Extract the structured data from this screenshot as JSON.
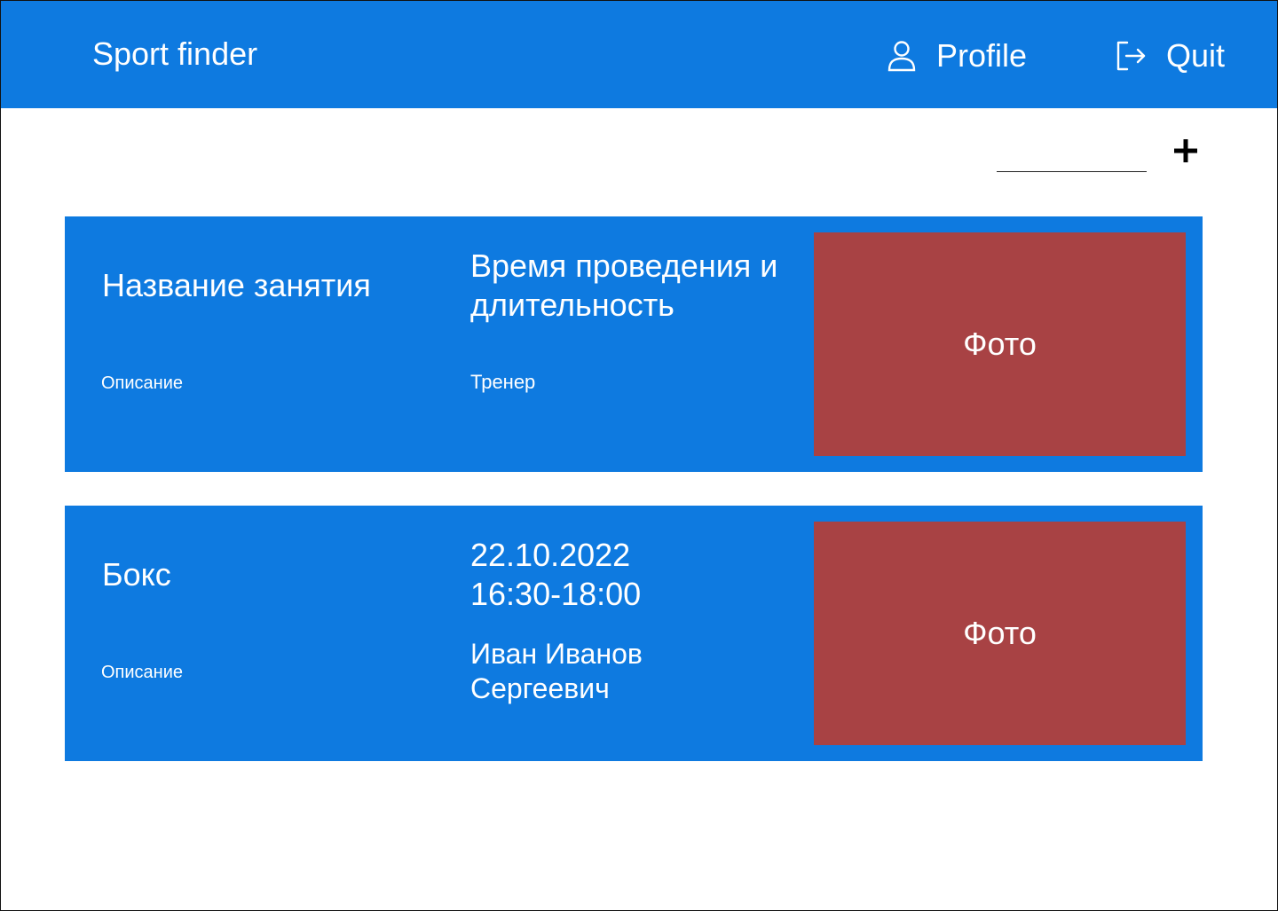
{
  "app": {
    "title": "Sport finder"
  },
  "nav": {
    "profile_label": "Profile",
    "profile_icon": "user-icon",
    "quit_label": "Quit",
    "quit_icon": "logout-icon"
  },
  "toolbar": {
    "add_icon": "plus-icon"
  },
  "colors": {
    "header": "#0e7ae0",
    "card": "#0e7ae0",
    "photo": "#a84244"
  },
  "cards": [
    {
      "title": "Название занятия",
      "description": "Описание",
      "time": "Время проведения и длительность",
      "trainer": "Тренер",
      "photo_label": "Фото"
    },
    {
      "title": "Бокс",
      "description": "Описание",
      "date": "22.10.2022",
      "time_range": "16:30-18:00",
      "trainer": "Иван Иванов Сергеевич",
      "photo_label": "Фото"
    }
  ]
}
